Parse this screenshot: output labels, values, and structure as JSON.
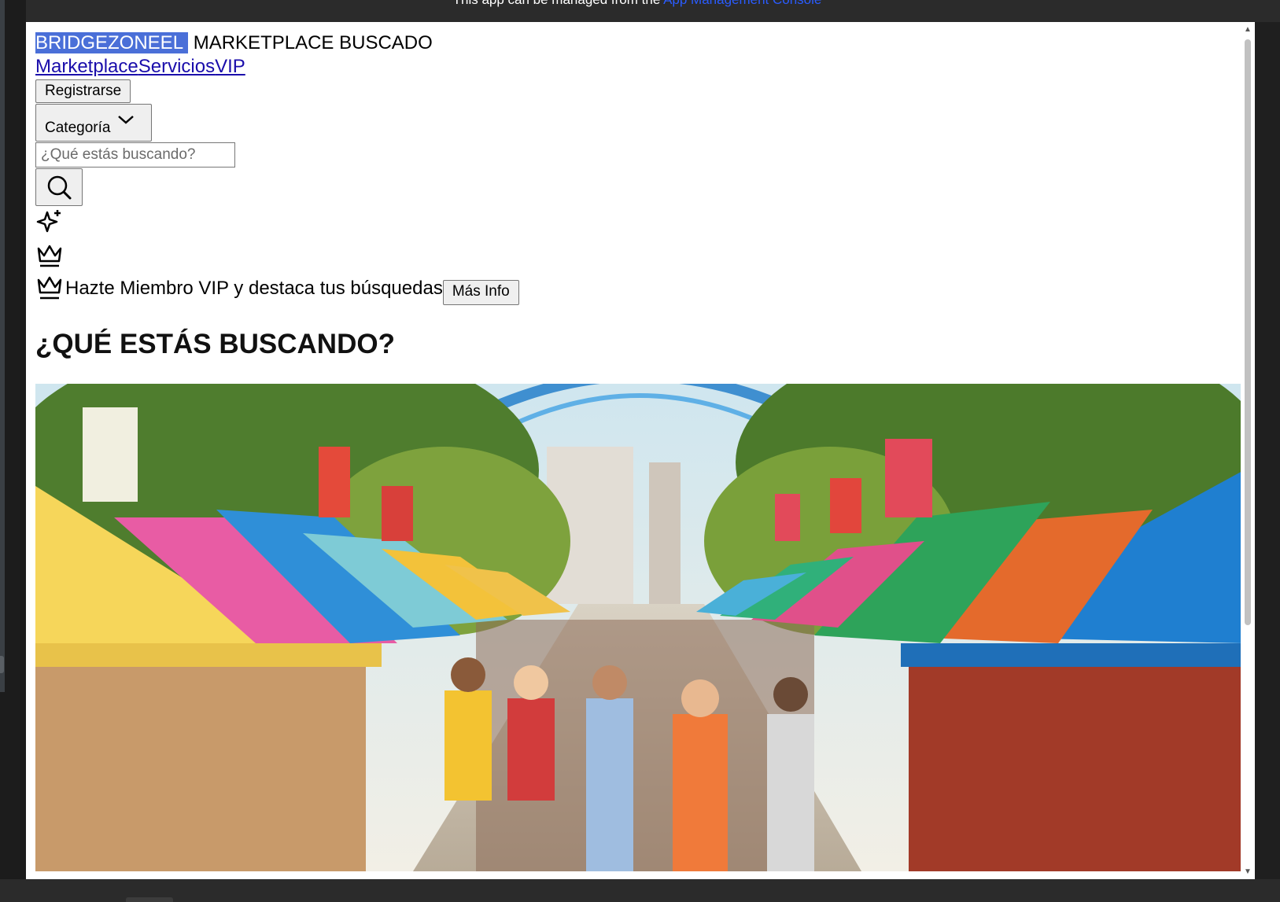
{
  "topbar": {
    "message": "This app can be managed from the",
    "link": "App Management Console"
  },
  "header": {
    "brand_highlight": "BRIDGEZONEEL",
    "brand_rest": "MARKETPLACE BUSCADO"
  },
  "nav": {
    "items": [
      {
        "label": "Marketplace"
      },
      {
        "label": "Servicios"
      },
      {
        "label": "VIP"
      }
    ]
  },
  "register_label": "Registrarse",
  "category": {
    "label": "Categoría",
    "icon": "chevron-down-icon"
  },
  "search": {
    "placeholder": "¿Qué estás buscando?",
    "button_icon": "search-icon"
  },
  "icons": [
    "sparkles-icon",
    "crown-icon"
  ],
  "vip_banner": {
    "icon": "crown-icon",
    "text": "Hazte Miembro VIP y destaca tus búsquedas",
    "button_label": "Más Info"
  },
  "main": {
    "heading": "¿QUÉ ESTÁS BUSCANDO?",
    "hero_image": "illustrated street market with colorful tents and crowd"
  },
  "colors": {
    "brand_highlight": "#4a6fd8",
    "link": "#1a0dab",
    "topbar_link": "#2a5cff"
  }
}
